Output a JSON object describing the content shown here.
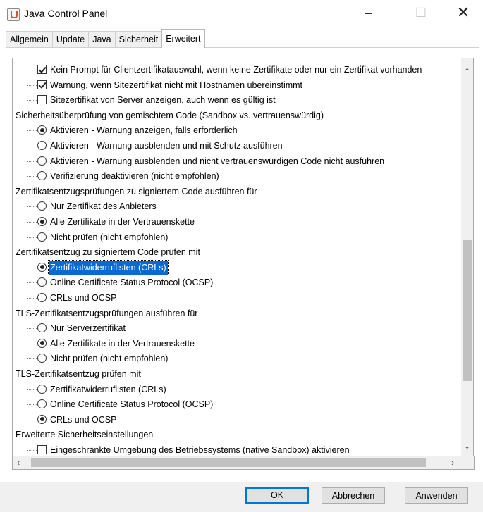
{
  "window": {
    "title": "Java Control Panel",
    "minimize": "–",
    "maximize": "☐",
    "close": "✕"
  },
  "tabs": [
    "Allgemein",
    "Update",
    "Java",
    "Sicherheit",
    "Erweitert"
  ],
  "active_tab": "Erweitert",
  "tree": {
    "items": [
      {
        "type": "checkbox",
        "checked": true,
        "label": "Kein Prompt für Clientzertifikatauswahl, wenn keine Zertifikate oder nur ein Zertifikat vorhanden"
      },
      {
        "type": "checkbox",
        "checked": true,
        "label": "Warnung, wenn Sitezertifikat nicht mit Hostnamen übereinstimmt"
      },
      {
        "type": "checkbox",
        "checked": false,
        "label": "Sitezertifikat von Server anzeigen, auch wenn es gültig ist"
      },
      {
        "type": "group",
        "label": "Sicherheitsüberprüfung von gemischtem Code (Sandbox vs. vertrauenswürdig)"
      },
      {
        "type": "radio",
        "checked": true,
        "label": "Aktivieren - Warnung anzeigen, falls erforderlich"
      },
      {
        "type": "radio",
        "checked": false,
        "label": "Aktivieren - Warnung ausblenden und mit Schutz ausführen"
      },
      {
        "type": "radio",
        "checked": false,
        "label": "Aktivieren - Warnung ausblenden und nicht vertrauenswürdigen Code nicht ausführen"
      },
      {
        "type": "radio",
        "checked": false,
        "label": "Verifizierung deaktivieren (nicht empfohlen)"
      },
      {
        "type": "group",
        "label": "Zertifikatsentzugsprüfungen zu signiertem Code ausführen für"
      },
      {
        "type": "radio",
        "checked": false,
        "label": "Nur Zertifikat des Anbieters"
      },
      {
        "type": "radio",
        "checked": true,
        "label": "Alle Zertifikate in der Vertrauenskette"
      },
      {
        "type": "radio",
        "checked": false,
        "label": "Nicht prüfen (nicht empfohlen)"
      },
      {
        "type": "group",
        "label": "Zertifikatsentzug zu signiertem Code prüfen mit"
      },
      {
        "type": "radio",
        "checked": true,
        "selected": true,
        "label": "Zertifikatwiderruflisten (CRLs)"
      },
      {
        "type": "radio",
        "checked": false,
        "label": "Online Certificate Status Protocol (OCSP)"
      },
      {
        "type": "radio",
        "checked": false,
        "label": "CRLs und OCSP"
      },
      {
        "type": "group",
        "label": "TLS-Zertifikatsentzugsprüfungen ausführen für"
      },
      {
        "type": "radio",
        "checked": false,
        "label": "Nur Serverzertifikat"
      },
      {
        "type": "radio",
        "checked": true,
        "label": "Alle Zertifikate in der Vertrauenskette"
      },
      {
        "type": "radio",
        "checked": false,
        "label": "Nicht prüfen (nicht empfohlen)"
      },
      {
        "type": "group",
        "label": "TLS-Zertifikatsentzug prüfen mit"
      },
      {
        "type": "radio",
        "checked": false,
        "label": "Zertifikatwiderruflisten (CRLs)"
      },
      {
        "type": "radio",
        "checked": false,
        "label": "Online Certificate Status Protocol (OCSP)"
      },
      {
        "type": "radio",
        "checked": true,
        "label": "CRLs und OCSP"
      },
      {
        "type": "group",
        "label": "Erweiterte Sicherheitseinstellungen"
      },
      {
        "type": "checkbox",
        "checked": false,
        "label": "Eingeschränkte Umgebung des Betriebssystems (native Sandbox) aktivieren"
      }
    ]
  },
  "scrollbars": {
    "up": "⌃",
    "down": "⌄",
    "left": "‹",
    "right": "›"
  },
  "buttons": {
    "ok": "OK",
    "cancel": "Abbrechen",
    "apply": "Anwenden"
  }
}
